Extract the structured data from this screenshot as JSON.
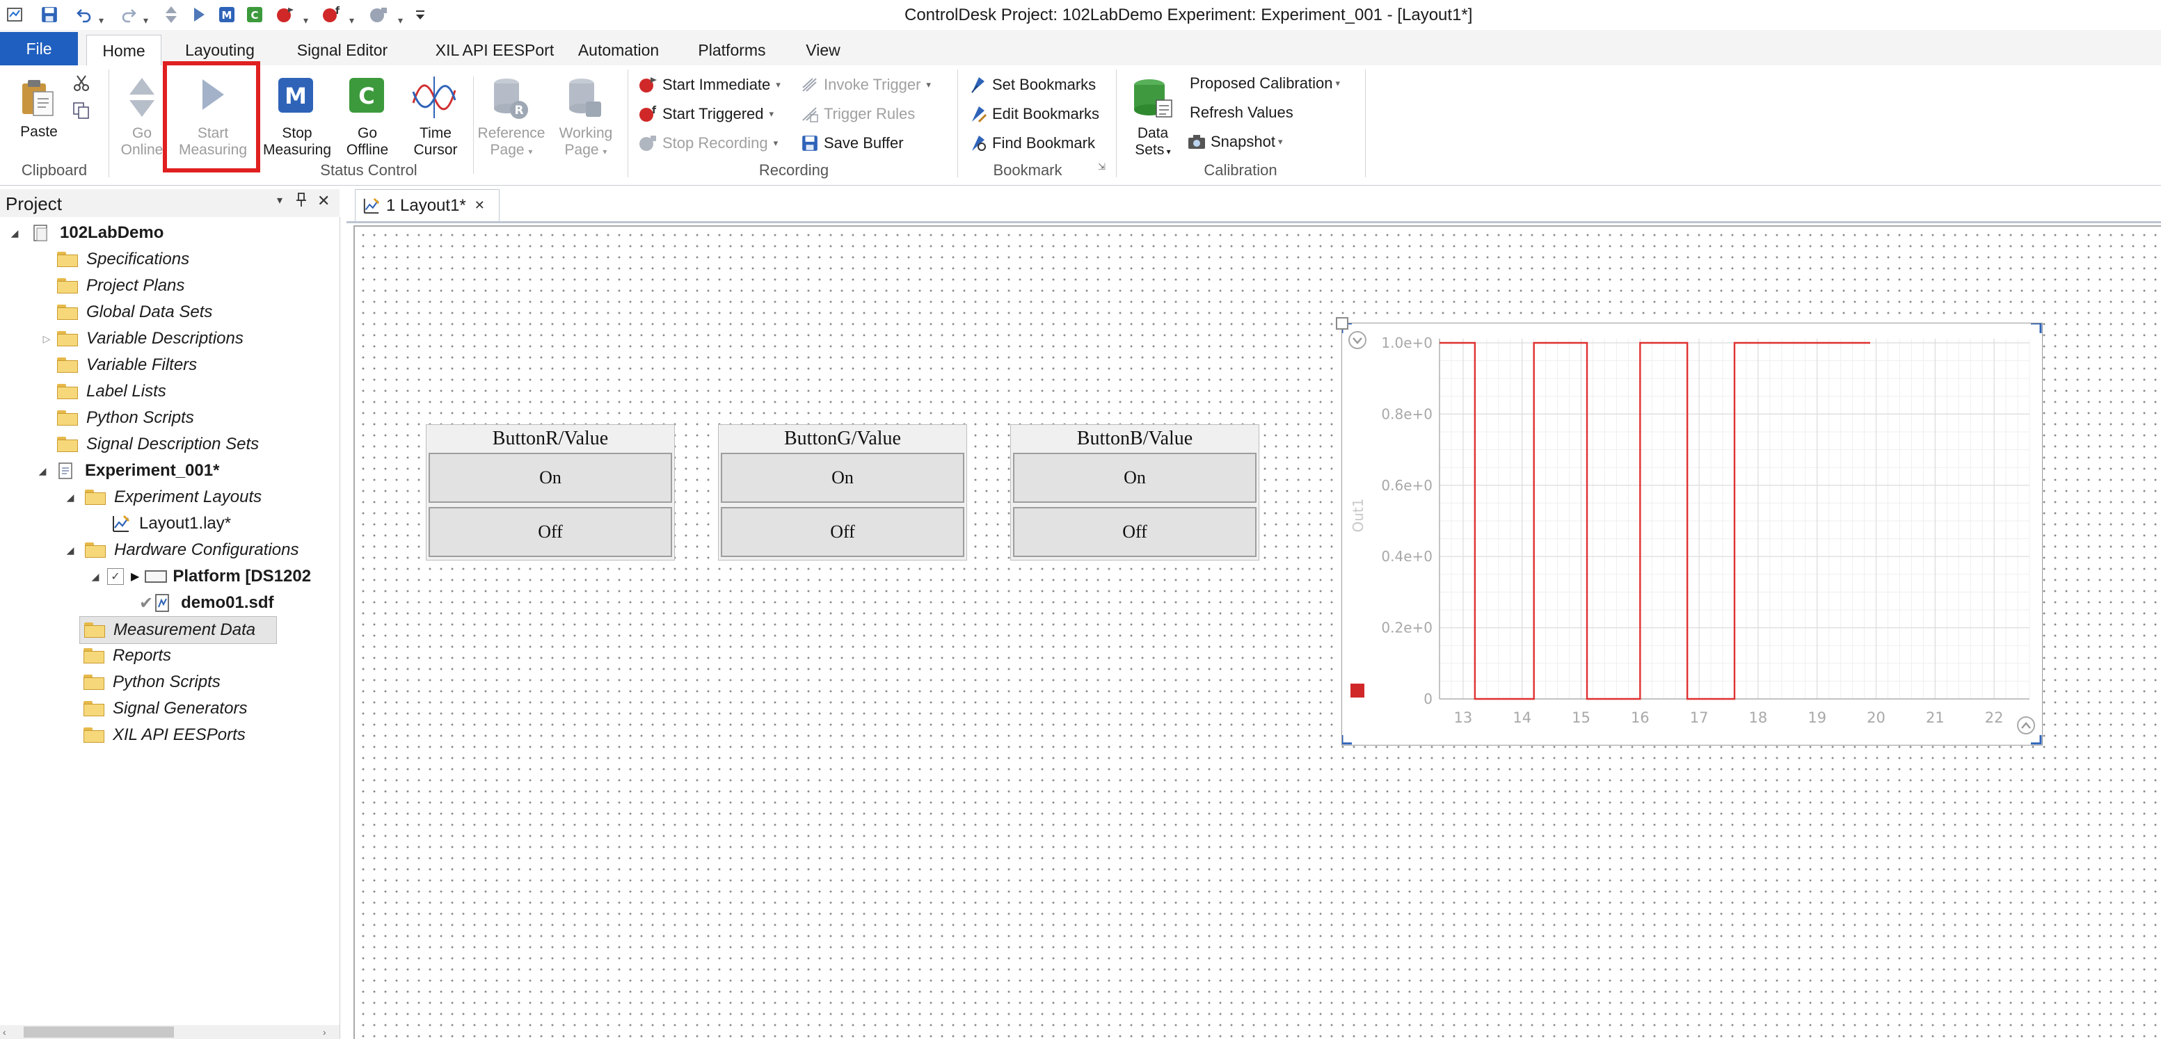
{
  "window": {
    "title": "ControlDesk  Project: 102LabDemo  Experiment: Experiment_001 - [Layout1*]"
  },
  "ribbon_tabs": [
    "File",
    "Home",
    "Layouting",
    "Signal Editor",
    "XIL API EESPort",
    "Automation",
    "Platforms",
    "View"
  ],
  "clipboard": {
    "paste": "Paste",
    "group": "Clipboard"
  },
  "status_control": {
    "go_online": [
      "Go",
      "Online"
    ],
    "start_measuring": [
      "Start",
      "Measuring"
    ],
    "stop_measuring": [
      "Stop",
      "Measuring"
    ],
    "go_offline": [
      "Go",
      "Offline"
    ],
    "time_cursor": [
      "Time",
      "Cursor"
    ],
    "reference_page": [
      "Reference",
      "Page"
    ],
    "working_page": [
      "Working",
      "Page"
    ],
    "group": "Status Control"
  },
  "recording": {
    "start_immediate": "Start Immediate",
    "start_triggered": "Start Triggered",
    "stop_recording": "Stop Recording",
    "invoke_trigger": "Invoke Trigger",
    "trigger_rules": "Trigger Rules",
    "save_buffer": "Save Buffer",
    "group": "Recording"
  },
  "bookmark": {
    "set": "Set Bookmarks",
    "edit": "Edit Bookmarks",
    "find": "Find Bookmark",
    "group": "Bookmark"
  },
  "calibration": {
    "data_sets": [
      "Data",
      "Sets"
    ],
    "proposed": "Proposed Calibration",
    "refresh": "Refresh Values",
    "snapshot": "Snapshot",
    "group": "Calibration"
  },
  "project_panel": {
    "title": "Project",
    "items": [
      {
        "label": "102LabDemo"
      },
      {
        "label": "Specifications"
      },
      {
        "label": "Project Plans"
      },
      {
        "label": "Global Data Sets"
      },
      {
        "label": "Variable Descriptions"
      },
      {
        "label": "Variable Filters"
      },
      {
        "label": "Label Lists"
      },
      {
        "label": "Python Scripts"
      },
      {
        "label": "Signal Description Sets"
      },
      {
        "label": "Experiment_001*"
      },
      {
        "label": "Experiment Layouts"
      },
      {
        "label": "Layout1.lay*"
      },
      {
        "label": "Hardware Configurations"
      },
      {
        "label": "Platform [DS1202"
      },
      {
        "label": "demo01.sdf"
      },
      {
        "label": "Measurement Data"
      },
      {
        "label": "Reports"
      },
      {
        "label": "Python Scripts"
      },
      {
        "label": "Signal Generators"
      },
      {
        "label": "XIL API EESPorts"
      }
    ]
  },
  "doc_tab": {
    "label": "1 Layout1*"
  },
  "instruments": [
    {
      "title": "ButtonR/Value",
      "on": "On",
      "off": "Off"
    },
    {
      "title": "ButtonG/Value",
      "on": "On",
      "off": "Off"
    },
    {
      "title": "ButtonB/Value",
      "on": "On",
      "off": "Off"
    }
  ],
  "chart_data": {
    "type": "line",
    "title": "",
    "xlabel": "",
    "ylabel": "Out1",
    "xlim": [
      12.6,
      22.6
    ],
    "ylim": [
      0,
      1.0
    ],
    "x_ticks": [
      "13",
      "14",
      "15",
      "16",
      "17",
      "18",
      "19",
      "20",
      "21",
      "22"
    ],
    "y_ticks": [
      "0",
      "0.2e+0",
      "0.4e+0",
      "0.6e+0",
      "0.8e+0",
      "1.0e+0"
    ],
    "grid": true,
    "color": "#e03030",
    "series": [
      {
        "name": "",
        "x": [
          12.6,
          13.2,
          13.2,
          14.2,
          14.2,
          15.1,
          15.1,
          16.0,
          16.0,
          16.8,
          16.8,
          17.6,
          17.6,
          19.9
        ],
        "y": [
          1,
          1,
          0,
          0,
          1,
          1,
          0,
          0,
          1,
          1,
          0,
          0,
          1,
          1
        ]
      }
    ]
  }
}
